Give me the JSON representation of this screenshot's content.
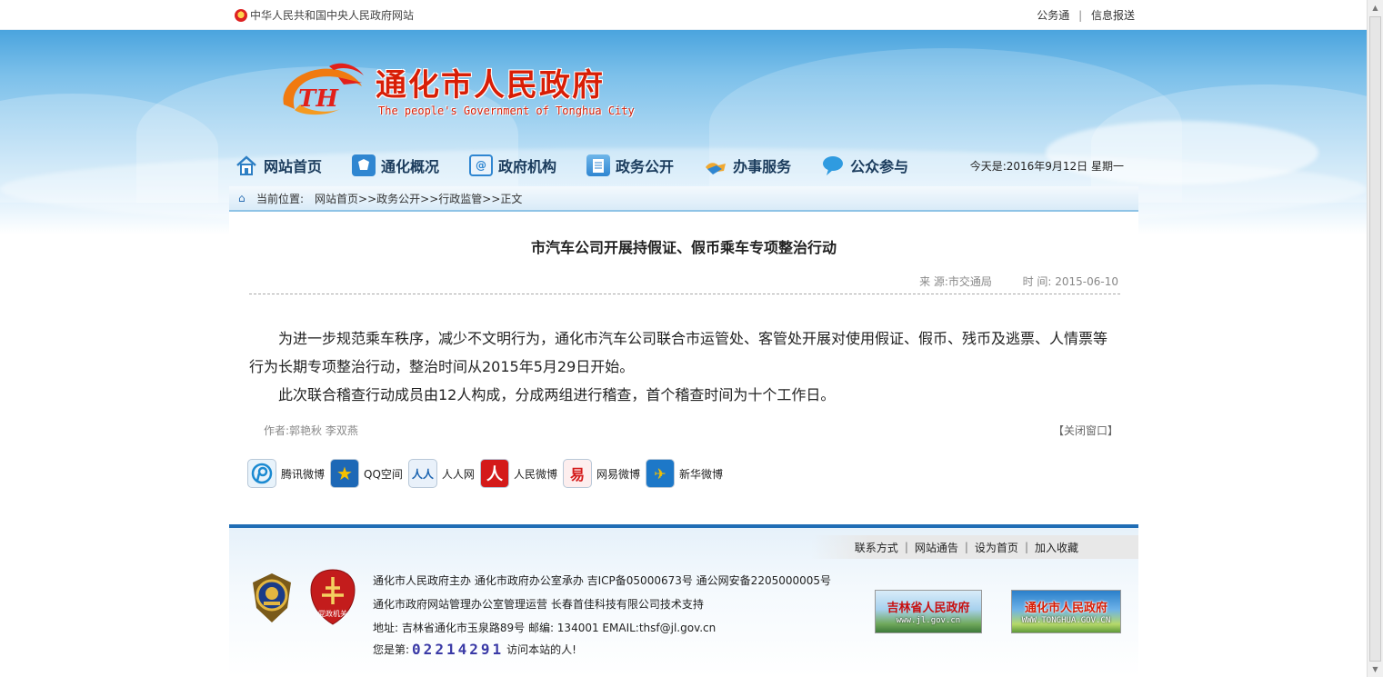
{
  "topbar": {
    "gov_link": "中华人民共和国中央人民政府网站",
    "links": [
      "公务通",
      "信息报送"
    ]
  },
  "header": {
    "title": "通化市人民政府",
    "subtitle": "The people's Government of Tonghua City",
    "logo_letters": "TH"
  },
  "nav": {
    "items": [
      {
        "label": "网站首页",
        "icon": "home-icon"
      },
      {
        "label": "通化概况",
        "icon": "map-icon"
      },
      {
        "label": "政府机构",
        "icon": "building-icon"
      },
      {
        "label": "政务公开",
        "icon": "document-icon"
      },
      {
        "label": "办事服务",
        "icon": "handshake-icon"
      },
      {
        "label": "公众参与",
        "icon": "chat-bubble-icon"
      }
    ],
    "date": "今天是:2016年9月12日   星期一"
  },
  "breadcrumb": {
    "label": "当前位置:",
    "path": "网站首页>>政务公开>>行政监管>>正文"
  },
  "article": {
    "title": "市汽车公司开展持假证、假币乘车专项整治行动",
    "source": "来 源:市交通局",
    "time": "时 间: 2015-06-10",
    "paragraphs": [
      "为进一步规范乘车秩序，减少不文明行为，通化市汽车公司联合市运管处、客管处开展对使用假证、假币、残币及逃票、人情票等行为长期专项整治行动，整治时间从2015年5月29日开始。",
      "此次联合稽查行动成员由12人构成，分成两组进行稽查，首个稽查时间为十个工作日。"
    ],
    "author": "作者:郭艳秋 李双燕",
    "close_window": "【关闭窗口】"
  },
  "share": [
    {
      "label": "腾讯微博",
      "icon": "tencent-weibo-icon",
      "glyph": "P",
      "color": "#1b8ad1"
    },
    {
      "label": "QQ空间",
      "icon": "qzone-icon",
      "glyph": "★",
      "color": "#f5b400"
    },
    {
      "label": "人人网",
      "icon": "renren-icon",
      "glyph": "人人",
      "color": "#1a63b0"
    },
    {
      "label": "人民微博",
      "icon": "people-weibo-icon",
      "glyph": "人",
      "color": "#d41a1a"
    },
    {
      "label": "网易微博",
      "icon": "netease-weibo-icon",
      "glyph": "易",
      "color": "#d41a1a"
    },
    {
      "label": "新华微博",
      "icon": "xinhua-weibo-icon",
      "glyph": "✈",
      "color": "#f3a300"
    }
  ],
  "footer": {
    "links": [
      "联系方式",
      "网站通告",
      "设为首页",
      "加入收藏"
    ],
    "lines": [
      "通化市人民政府主办  通化市政府办公室承办  吉ICP备05000673号  通公网安备2205000005号",
      "通化市政府网站管理办公室管理运营  长春首佳科技有限公司技术支持",
      "地址: 吉林省通化市玉泉路89号  邮编: 134001  EMAIL:thsf@jl.gov.cn"
    ],
    "counter_prefix": "您是第:",
    "counter": "02214291",
    "counter_suffix": "访问本站的人!",
    "party_badge_label": "党政机关",
    "banner1": {
      "title": "吉林省人民政府",
      "url": "www.jl.gov.cn"
    },
    "banner2": {
      "title": "通化市人民政府",
      "url": "WWW.TONGHUA.GOV.CN"
    }
  }
}
